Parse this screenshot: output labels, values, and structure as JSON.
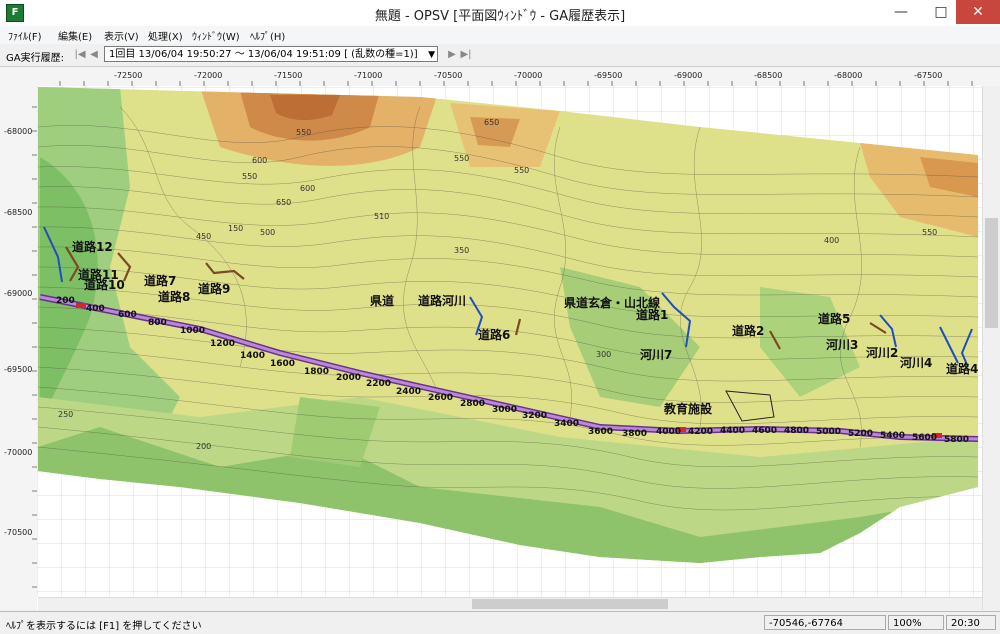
{
  "window": {
    "title": "無題 - OPSV [平面図ｳｨﾝﾄﾞｳ - GA履歴表示]",
    "app_icon_glyph": "F"
  },
  "menu": [
    {
      "label": "ﾌｧｲﾙ(F)"
    },
    {
      "label": "編集(E)"
    },
    {
      "label": "表示(V)"
    },
    {
      "label": "処理(X)"
    },
    {
      "label": "ｳｨﾝﾄﾞｳ(W)"
    },
    {
      "label": "ﾍﾙﾌﾟ(H)"
    }
  ],
  "toolbar": {
    "label": "GA実行履歴:",
    "history_selected": "1回目  13/06/04 19:50:27 ～ 13/06/04 19:51:09 [ (乱数の種=1)]"
  },
  "ruler_x": [
    "-72500",
    "-72000",
    "-71500",
    "-71000",
    "-70500",
    "-70000",
    "-69500",
    "-69000",
    "-68500",
    "-68000",
    "-67500"
  ],
  "ruler_y": [
    "-68000",
    "-68500",
    "-69000",
    "-69500",
    "-70000",
    "-70500"
  ],
  "map": {
    "elevation_labels": [
      "550",
      "650",
      "600",
      "550",
      "600",
      "650",
      "550",
      "550",
      "500",
      "450",
      "400",
      "350",
      "300",
      "250",
      "200",
      "150",
      "510",
      "550",
      "410"
    ],
    "station_labels": [
      "200",
      "400",
      "600",
      "800",
      "1000",
      "1200",
      "1400",
      "1600",
      "1800",
      "2000",
      "2200",
      "2400",
      "2600",
      "2800",
      "3000",
      "3200",
      "3400",
      "3600",
      "3800",
      "4000",
      "4200",
      "4400",
      "4600",
      "4800",
      "5000",
      "5200",
      "5400",
      "5600",
      "5800"
    ],
    "feature_labels": [
      "道路12",
      "道路11",
      "道路10",
      "道路7",
      "道路8",
      "道路9",
      "県道",
      "道路",
      "河川",
      "道路6",
      "県道玄倉・山北線",
      "道路1",
      "河川7",
      "道路2",
      "河川3",
      "河川2",
      "河川4",
      "道路4",
      "教育施設",
      "道路5"
    ],
    "colors": {
      "route": "#9b5fc0",
      "route_dark": "#6a2f8f",
      "route_red": "#d8262a",
      "river": "#1f4fbf",
      "road": "#7a4a24"
    }
  },
  "status": {
    "help_text": "ﾍﾙﾌﾟを表示するには [F1] を押してください",
    "coordinates": "-70546,-67764",
    "zoom": "100%",
    "time": "20:30"
  }
}
